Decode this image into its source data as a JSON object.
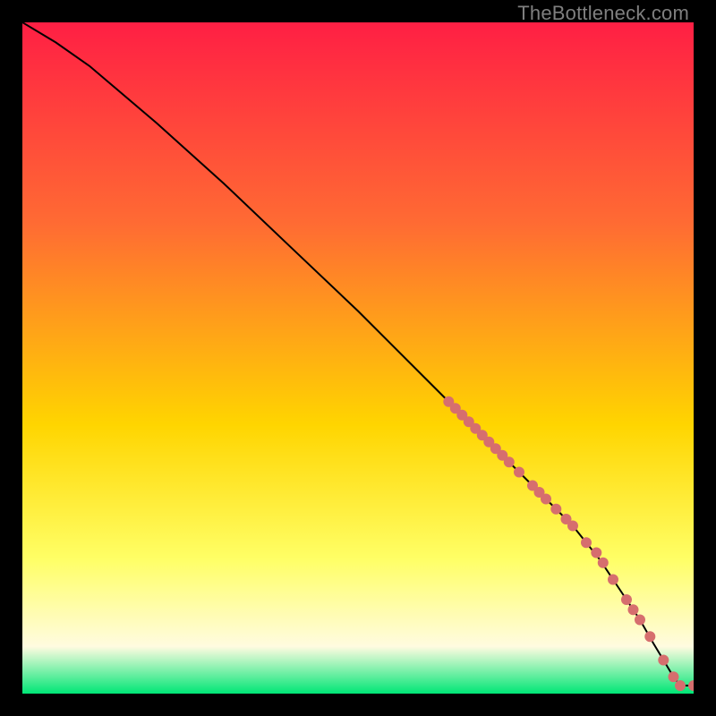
{
  "watermark": "TheBottleneck.com",
  "colors": {
    "gradient_top": "#ff1f44",
    "gradient_mid_upper": "#ff6b33",
    "gradient_mid": "#ffd500",
    "gradient_mid_lower": "#ffff66",
    "gradient_cream": "#fffbe0",
    "gradient_green": "#00e676",
    "curve": "#000000",
    "marker": "#d66e6e",
    "frame_bg": "#000000"
  },
  "chart_data": {
    "type": "line",
    "title": "",
    "xlabel": "",
    "ylabel": "",
    "xlim": [
      0,
      100
    ],
    "ylim": [
      0,
      100
    ],
    "series": [
      {
        "name": "curve",
        "x": [
          0,
          5,
          10,
          20,
          30,
          40,
          50,
          60,
          63,
          66,
          69,
          72,
          74,
          76,
          78,
          80,
          82,
          84,
          86,
          88,
          90,
          92,
          94,
          95.5,
          97,
          98,
          100
        ],
        "y": [
          100,
          97,
          93.5,
          85,
          76,
          66.5,
          57,
          47,
          44,
          41,
          38,
          35,
          33,
          31,
          29,
          27,
          25,
          22.5,
          20,
          17,
          14,
          11,
          7.5,
          5,
          2.5,
          1.2,
          1.2
        ]
      }
    ],
    "markers": [
      {
        "x": 63.5,
        "y": 43.5
      },
      {
        "x": 64.5,
        "y": 42.5
      },
      {
        "x": 65.5,
        "y": 41.5
      },
      {
        "x": 66.5,
        "y": 40.5
      },
      {
        "x": 67.5,
        "y": 39.5
      },
      {
        "x": 68.5,
        "y": 38.5
      },
      {
        "x": 69.5,
        "y": 37.5
      },
      {
        "x": 70.5,
        "y": 36.5
      },
      {
        "x": 71.5,
        "y": 35.5
      },
      {
        "x": 72.5,
        "y": 34.5
      },
      {
        "x": 74.0,
        "y": 33.0
      },
      {
        "x": 76.0,
        "y": 31.0
      },
      {
        "x": 77.0,
        "y": 30.0
      },
      {
        "x": 78.0,
        "y": 29.0
      },
      {
        "x": 79.5,
        "y": 27.5
      },
      {
        "x": 81.0,
        "y": 26.0
      },
      {
        "x": 82.0,
        "y": 25.0
      },
      {
        "x": 84.0,
        "y": 22.5
      },
      {
        "x": 85.5,
        "y": 21.0
      },
      {
        "x": 86.5,
        "y": 19.5
      },
      {
        "x": 88.0,
        "y": 17.0
      },
      {
        "x": 90.0,
        "y": 14.0
      },
      {
        "x": 91.0,
        "y": 12.5
      },
      {
        "x": 92.0,
        "y": 11.0
      },
      {
        "x": 93.5,
        "y": 8.5
      },
      {
        "x": 95.5,
        "y": 5.0
      },
      {
        "x": 97.0,
        "y": 2.5
      },
      {
        "x": 98.0,
        "y": 1.2
      },
      {
        "x": 100.0,
        "y": 1.2
      }
    ]
  }
}
